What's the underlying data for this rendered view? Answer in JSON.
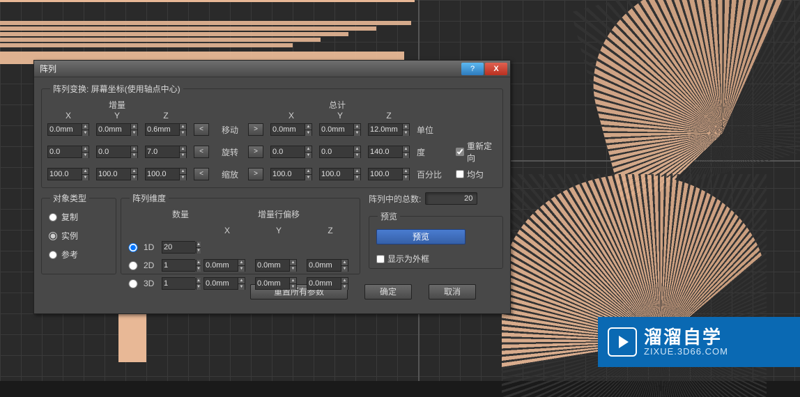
{
  "dialog": {
    "title": "阵列",
    "help_icon": "?",
    "close_icon": "X"
  },
  "transform_group": {
    "legend": "阵列变换: 屏幕坐标(使用轴点中心)",
    "incremental_label": "增量",
    "total_label": "总计",
    "axis": {
      "x": "X",
      "y": "Y",
      "z": "Z"
    },
    "rows": {
      "move": {
        "ix": "0.0mm",
        "iy": "0.0mm",
        "iz": "0.6mm",
        "label": "移动",
        "tx": "0.0mm",
        "ty": "0.0mm",
        "tz": "12.0mm",
        "unit": "单位"
      },
      "rotate": {
        "ix": "0.0",
        "iy": "0.0",
        "iz": "7.0",
        "label": "旋转",
        "tx": "0.0",
        "ty": "0.0",
        "tz": "140.0",
        "unit": "度",
        "reorient_label": "重新定向",
        "reorient_checked": true
      },
      "scale": {
        "ix": "100.0",
        "iy": "100.0",
        "iz": "100.0",
        "label": "缩放",
        "tx": "100.0",
        "ty": "100.0",
        "tz": "100.0",
        "unit": "百分比",
        "uniform_label": "均匀",
        "uniform_checked": false
      }
    },
    "left_arrow": "<",
    "right_arrow": ">"
  },
  "object_type": {
    "legend": "对象类型",
    "options": [
      "复制",
      "实例",
      "参考"
    ],
    "selected": "实例"
  },
  "array_dim": {
    "legend": "阵列维度",
    "count_label": "数量",
    "row_offset_label": "增量行偏移",
    "axis": {
      "x": "X",
      "y": "Y",
      "z": "Z"
    },
    "rows": {
      "d1": {
        "label": "1D",
        "count": "20"
      },
      "d2": {
        "label": "2D",
        "count": "1",
        "x": "0.0mm",
        "y": "0.0mm",
        "z": "0.0mm"
      },
      "d3": {
        "label": "3D",
        "count": "1",
        "x": "0.0mm",
        "y": "0.0mm",
        "z": "0.0mm"
      }
    },
    "selected": "1D"
  },
  "total_count": {
    "label": "阵列中的总数:",
    "value": "20"
  },
  "preview": {
    "legend": "预览",
    "button": "预览",
    "wireframe_label": "显示为外框",
    "wireframe_checked": false
  },
  "footer": {
    "reset": "重置所有参数",
    "ok": "确定",
    "cancel": "取消"
  },
  "watermark": {
    "line1": "溜溜自学",
    "line2": "ZIXUE.3D66.COM"
  }
}
